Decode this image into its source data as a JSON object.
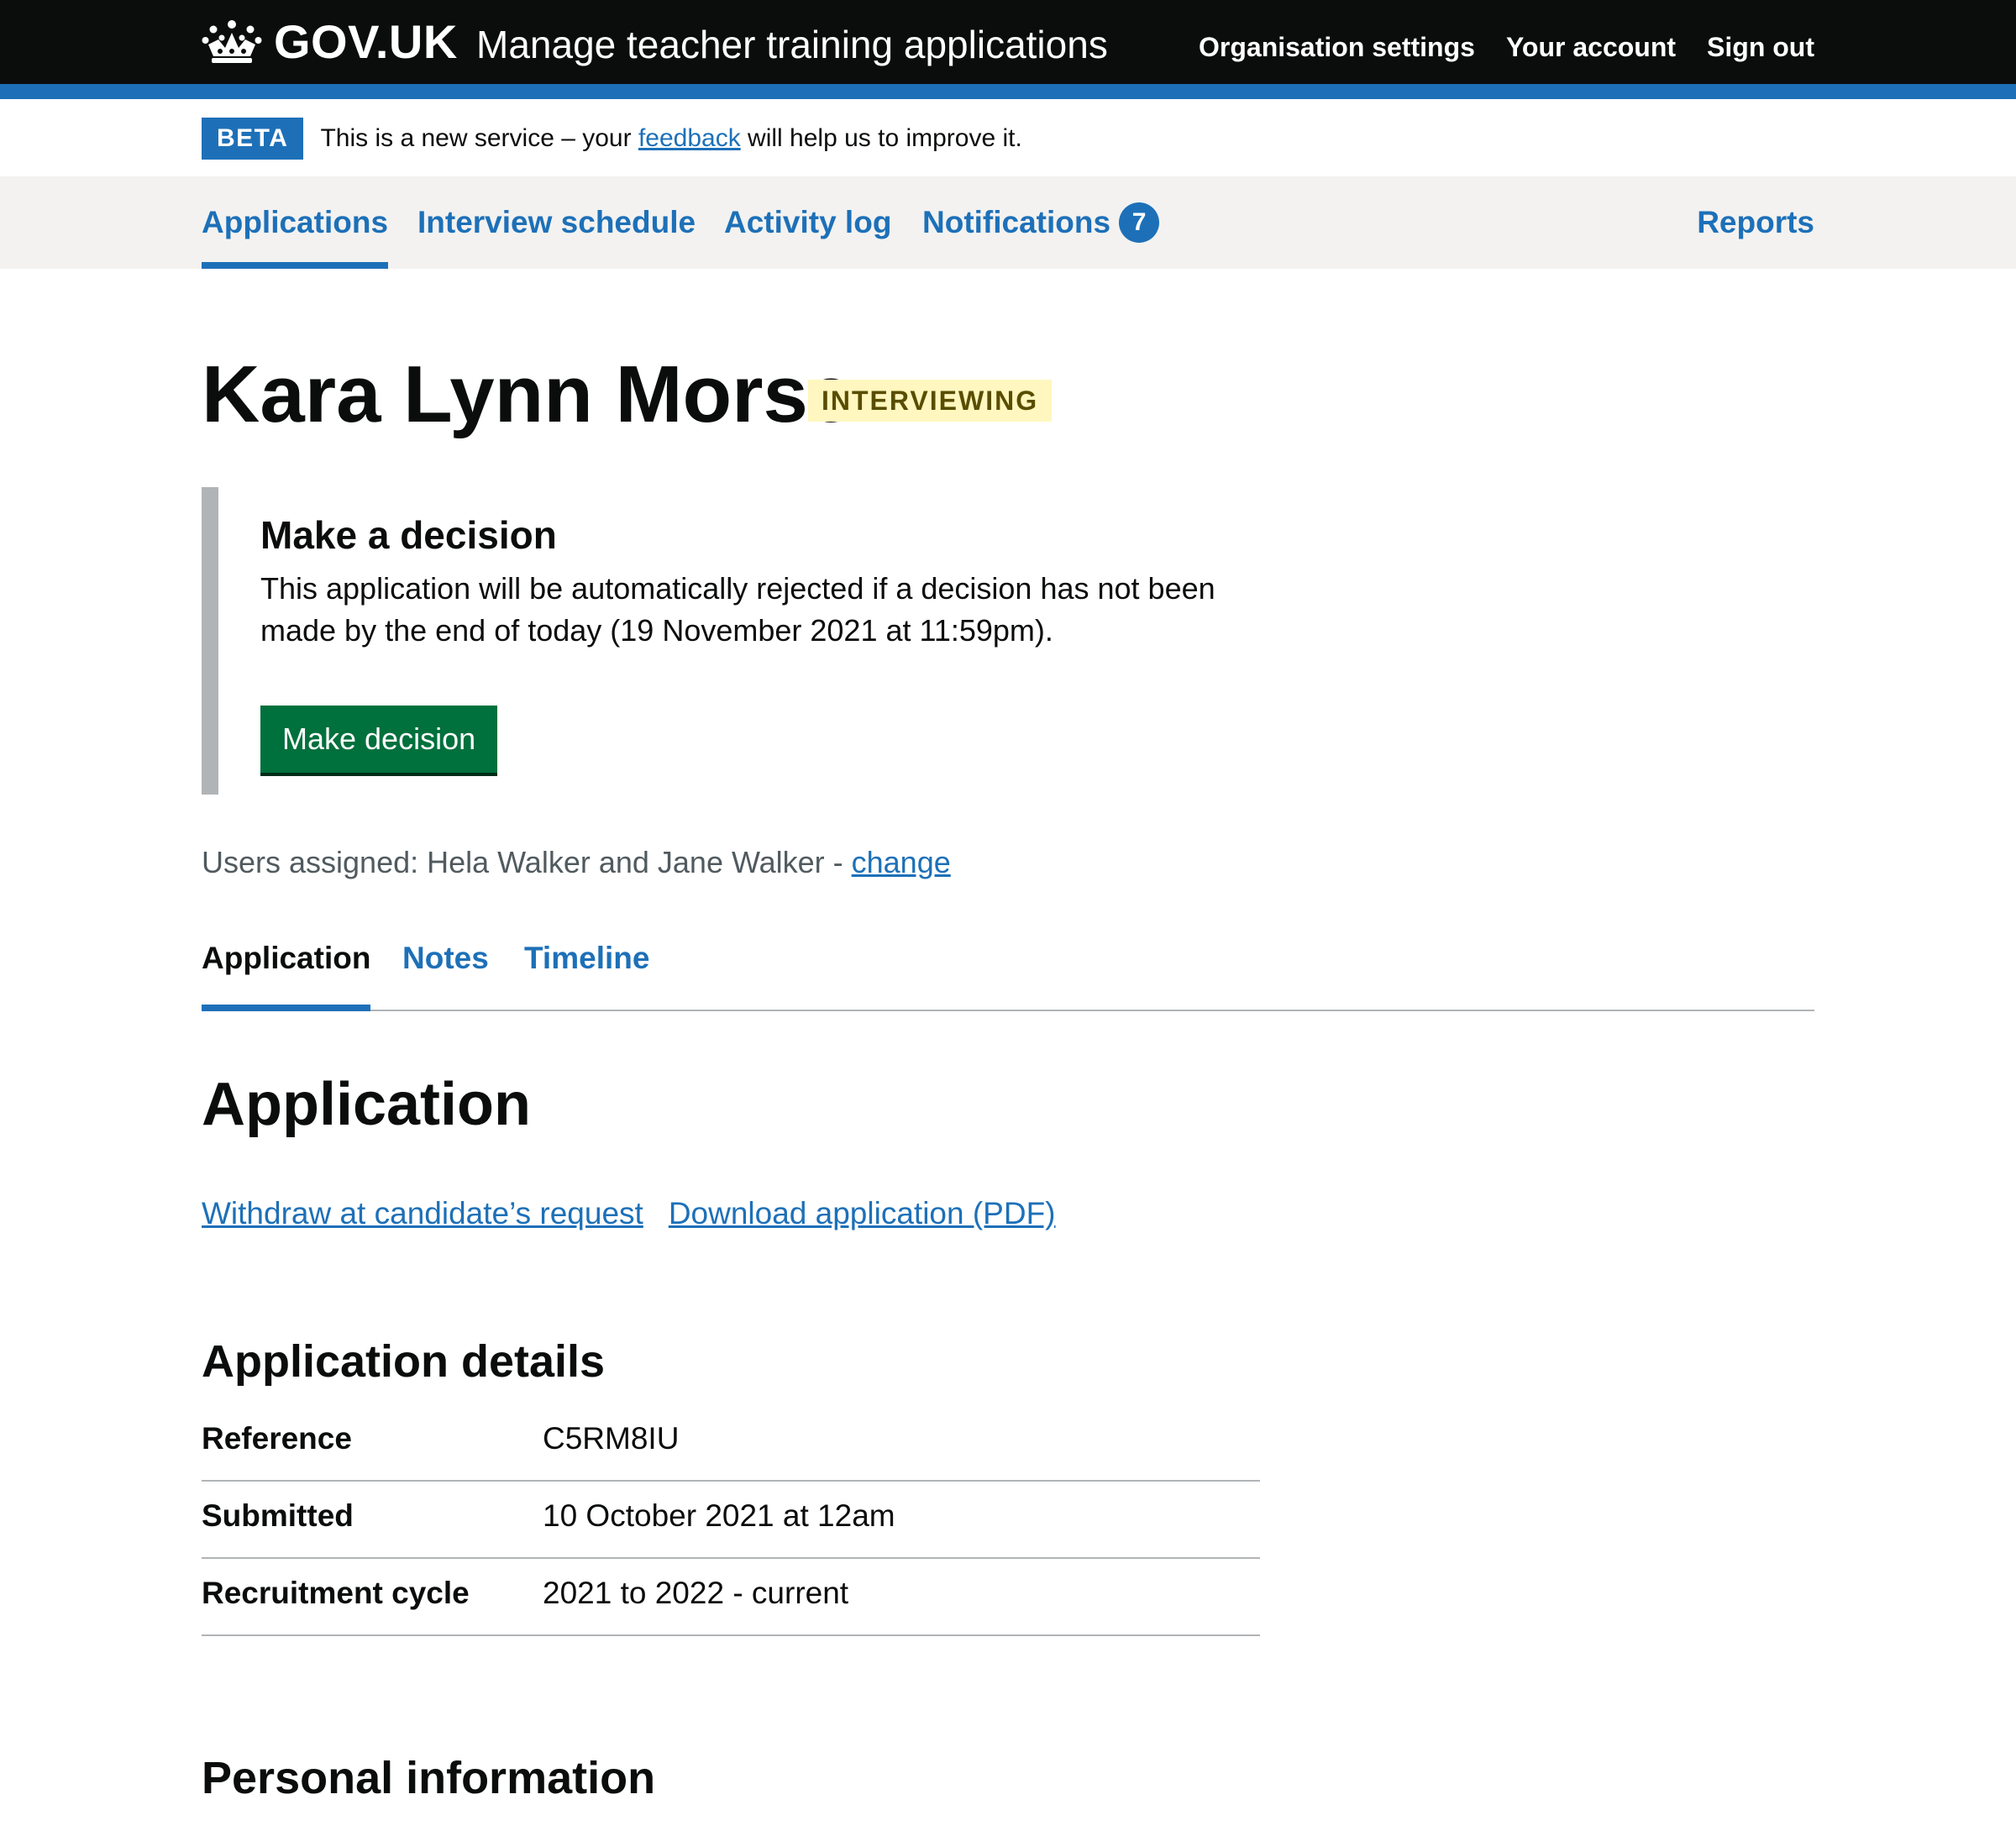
{
  "header": {
    "logo_text": "GOV.UK",
    "service_name": "Manage teacher training applications",
    "nav": {
      "org_settings": "Organisation settings",
      "account": "Your account",
      "sign_out": "Sign out"
    }
  },
  "phase_banner": {
    "tag": "BETA",
    "text_before": "This is a new service – your ",
    "link": "feedback",
    "text_after": " will help us to improve it."
  },
  "primary_nav": {
    "applications": "Applications",
    "interview_schedule": "Interview schedule",
    "activity_log": "Activity log",
    "notifications": "Notifications",
    "notifications_count": "7",
    "reports": "Reports",
    "active": "Applications"
  },
  "candidate": {
    "name": "Kara Lynn Morse",
    "status": "INTERVIEWING"
  },
  "decision": {
    "title": "Make a decision",
    "body": "This application will be automatically rejected if a decision has not been made by the end of today (19 November 2021 at 11:59pm).",
    "button": "Make decision"
  },
  "assignment": {
    "text": "Users assigned: Hela Walker and Jane Walker - ",
    "link": "change"
  },
  "tabs": {
    "application": "Application",
    "notes": "Notes",
    "timeline": "Timeline",
    "selected": "Application"
  },
  "main": {
    "title": "Application",
    "actions": {
      "withdraw": "Withdraw at candidate’s request",
      "download": "Download application (PDF)"
    },
    "details_title": "Application details",
    "details": [
      {
        "key": "Reference",
        "value": "C5RM8IU"
      },
      {
        "key": "Submitted",
        "value": "10 October 2021 at 12am"
      },
      {
        "key": "Recruitment cycle",
        "value": "2021 to 2022 - current"
      }
    ],
    "personal_title": "Personal information"
  },
  "colors": {
    "brand_blue": "#1d70b8",
    "header_black": "#0b0c0c",
    "button_green": "#00703c",
    "tag_yellow_bg": "#fff7bf",
    "tag_yellow_text": "#594d00"
  }
}
